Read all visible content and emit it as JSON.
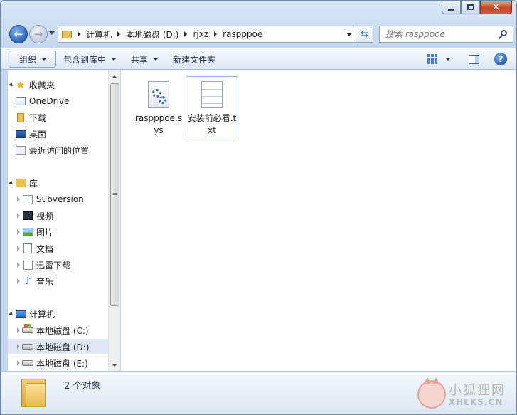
{
  "window": {
    "caption_buttons": [
      "minimize",
      "maximize",
      "close"
    ]
  },
  "address": {
    "crumbs": [
      "计算机",
      "本地磁盘 (D:)",
      "rjxz",
      "raspppoe"
    ]
  },
  "search": {
    "placeholder": "搜索 raspppoe"
  },
  "toolbar": {
    "organize": "组织",
    "include_in_library": "包含到库中",
    "share": "共享",
    "new_folder": "新建文件夹"
  },
  "nav": {
    "favorites": {
      "label": "收藏夹",
      "items": [
        {
          "label": "OneDrive",
          "icon": "onedrive-icon"
        },
        {
          "label": "下载",
          "icon": "downloads-icon"
        },
        {
          "label": "桌面",
          "icon": "desktop-icon"
        },
        {
          "label": "最近访问的位置",
          "icon": "recent-places-icon"
        }
      ]
    },
    "libraries": {
      "label": "库",
      "items": [
        {
          "label": "Subversion",
          "icon": "subversion-icon"
        },
        {
          "label": "视频",
          "icon": "video-icon"
        },
        {
          "label": "图片",
          "icon": "pictures-icon"
        },
        {
          "label": "文档",
          "icon": "documents-icon"
        },
        {
          "label": "迅雷下载",
          "icon": "xunlei-icon"
        },
        {
          "label": "音乐",
          "icon": "music-icon"
        }
      ]
    },
    "computer": {
      "label": "计算机",
      "items": [
        {
          "label": "本地磁盘 (C:)",
          "icon": "drive-c-icon"
        },
        {
          "label": "本地磁盘 (D:)",
          "icon": "drive-icon",
          "selected": true
        },
        {
          "label": "本地磁盘 (E:)",
          "icon": "drive-icon"
        }
      ]
    }
  },
  "files": [
    {
      "name": "raspppoe.sys",
      "icon": "system-file-icon"
    },
    {
      "name": "安装前必看.txt",
      "icon": "text-file-icon"
    }
  ],
  "details": {
    "status": "2 个对象"
  },
  "watermark": {
    "cn": "小狐狸网",
    "en": "XHLKS.CN"
  },
  "colors": {
    "accent": "#2c64b8",
    "selected_bg": "#dfe8f3",
    "chrome": "#c4d7ee"
  }
}
